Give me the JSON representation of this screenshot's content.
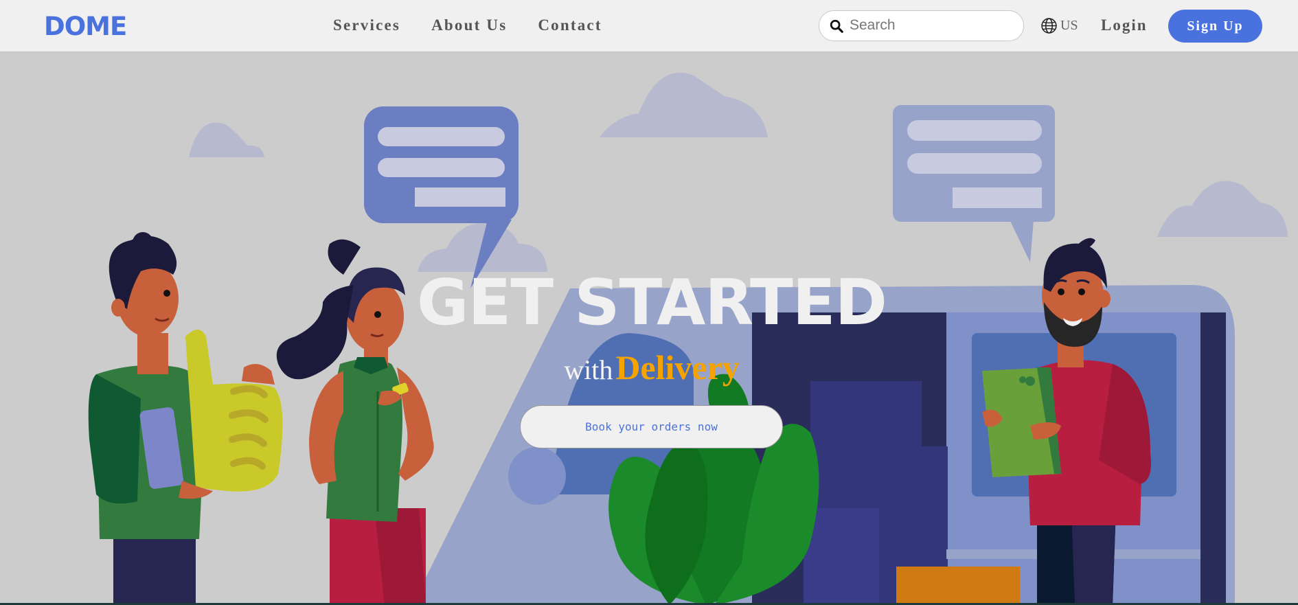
{
  "brand": {
    "logo": "DOME",
    "accent": "#4a72df"
  },
  "nav": {
    "links": [
      "Services",
      "About Us",
      "Contact"
    ]
  },
  "search": {
    "placeholder": "Search",
    "value": "",
    "icon": "search-icon"
  },
  "language": {
    "label": "US",
    "icon": "globe-icon"
  },
  "auth": {
    "login_label": "Login",
    "signup_label": "Sign Up"
  },
  "hero": {
    "title": "GET STARTED",
    "subtitle_with": "with",
    "subtitle_highlight": "Delivery",
    "highlight_color": "#f5a300",
    "cta_label": "Book your orders now"
  }
}
